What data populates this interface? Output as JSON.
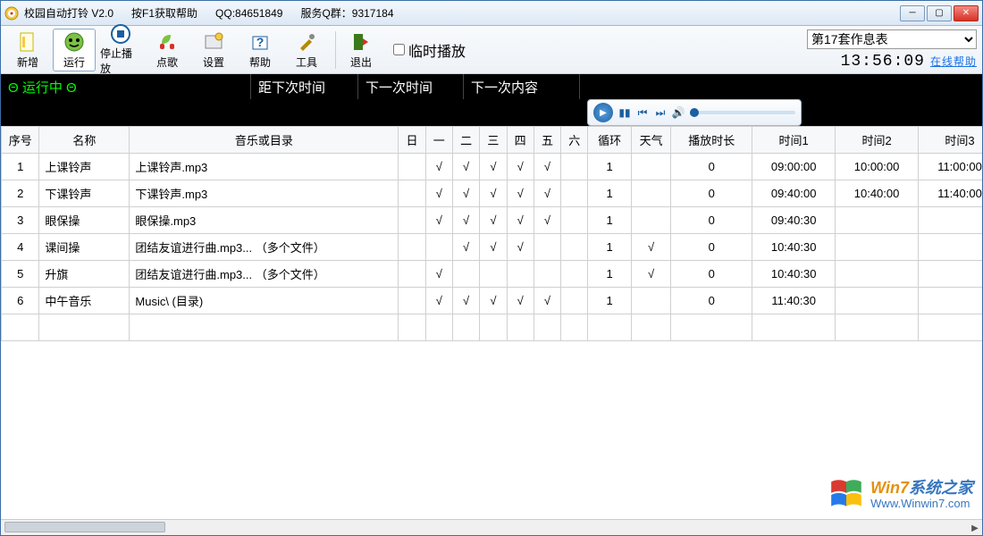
{
  "titlebar": {
    "title": "校园自动打铃 V2.0",
    "help_hint": "按F1获取帮助",
    "qq": "QQ:84651849",
    "qgroup": "服务Q群：9317184"
  },
  "toolbar": {
    "new": "新增",
    "run": "运行",
    "stop": "停止播放",
    "song": "点歌",
    "settings": "设置",
    "help": "帮助",
    "tools": "工具",
    "exit": "退出",
    "temp_play": "临时播放",
    "schedule_selected": "第17套作息表",
    "clock": "13:56:09",
    "online_help": "在线帮助"
  },
  "status": {
    "running": "Θ 运行中 Θ",
    "next_count": "距下次时间",
    "next_time": "下一次时间",
    "next_content": "下一次内容"
  },
  "columns": [
    "序号",
    "名称",
    "音乐或目录",
    "日",
    "一",
    "二",
    "三",
    "四",
    "五",
    "六",
    "循环",
    "天气",
    "播放时长",
    "时间1",
    "时间2",
    "时间3"
  ],
  "rows": [
    {
      "seq": "1",
      "name": "上课铃声",
      "music": "上课铃声.mp3",
      "days": [
        "",
        "√",
        "√",
        "√",
        "√",
        "√",
        ""
      ],
      "loop": "1",
      "weather": "",
      "dur": "0",
      "t1": "09:00:00",
      "t2": "10:00:00",
      "t3": "11:00:00"
    },
    {
      "seq": "2",
      "name": "下课铃声",
      "music": "下课铃声.mp3",
      "days": [
        "",
        "√",
        "√",
        "√",
        "√",
        "√",
        ""
      ],
      "loop": "1",
      "weather": "",
      "dur": "0",
      "t1": "09:40:00",
      "t2": "10:40:00",
      "t3": "11:40:00"
    },
    {
      "seq": "3",
      "name": "眼保操",
      "music": "眼保操.mp3",
      "days": [
        "",
        "√",
        "√",
        "√",
        "√",
        "√",
        ""
      ],
      "loop": "1",
      "weather": "",
      "dur": "0",
      "t1": "09:40:30",
      "t2": "",
      "t3": ""
    },
    {
      "seq": "4",
      "name": "课间操",
      "music": "团结友谊进行曲.mp3... （多个文件）",
      "days": [
        "",
        "",
        "√",
        "√",
        "√",
        "",
        ""
      ],
      "loop": "1",
      "weather": "√",
      "dur": "0",
      "t1": "10:40:30",
      "t2": "",
      "t3": ""
    },
    {
      "seq": "5",
      "name": "升旗",
      "music": "团结友谊进行曲.mp3... （多个文件）",
      "days": [
        "",
        "√",
        "",
        "",
        "",
        "",
        ""
      ],
      "loop": "1",
      "weather": "√",
      "dur": "0",
      "t1": "10:40:30",
      "t2": "",
      "t3": ""
    },
    {
      "seq": "6",
      "name": "中午音乐",
      "music": "Music\\ (目录)",
      "days": [
        "",
        "√",
        "√",
        "√",
        "√",
        "√",
        ""
      ],
      "loop": "1",
      "weather": "",
      "dur": "0",
      "t1": "11:40:30",
      "t2": "",
      "t3": ""
    }
  ],
  "watermark": {
    "brand_w": "Win7",
    "brand_rest": "系统之家",
    "url": "Www.Winwin7.com"
  }
}
